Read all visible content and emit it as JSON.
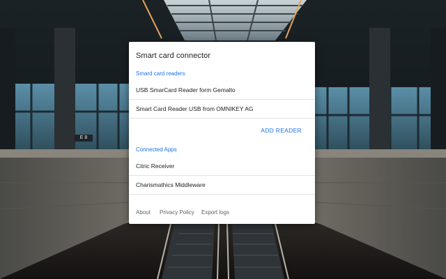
{
  "dialog": {
    "title": "Smart card connector",
    "readers_section_label": "Smard card readers",
    "readers": [
      "USB SmarCard Reader form Gemalto",
      "Smart Card Reader USB from OMNIKEY AG"
    ],
    "add_reader_label": "ADD READER",
    "apps_section_label": "Connected Apps",
    "apps": [
      "Citric Receiver",
      "Charismathics Middleware"
    ],
    "footer": {
      "about": "About",
      "privacy": "Privacy Policy",
      "export": "Export logs"
    }
  },
  "background": {
    "sign_text": "E 8"
  },
  "colors": {
    "accent": "#1a73e8",
    "text": "#202124",
    "muted": "#5f6368"
  }
}
